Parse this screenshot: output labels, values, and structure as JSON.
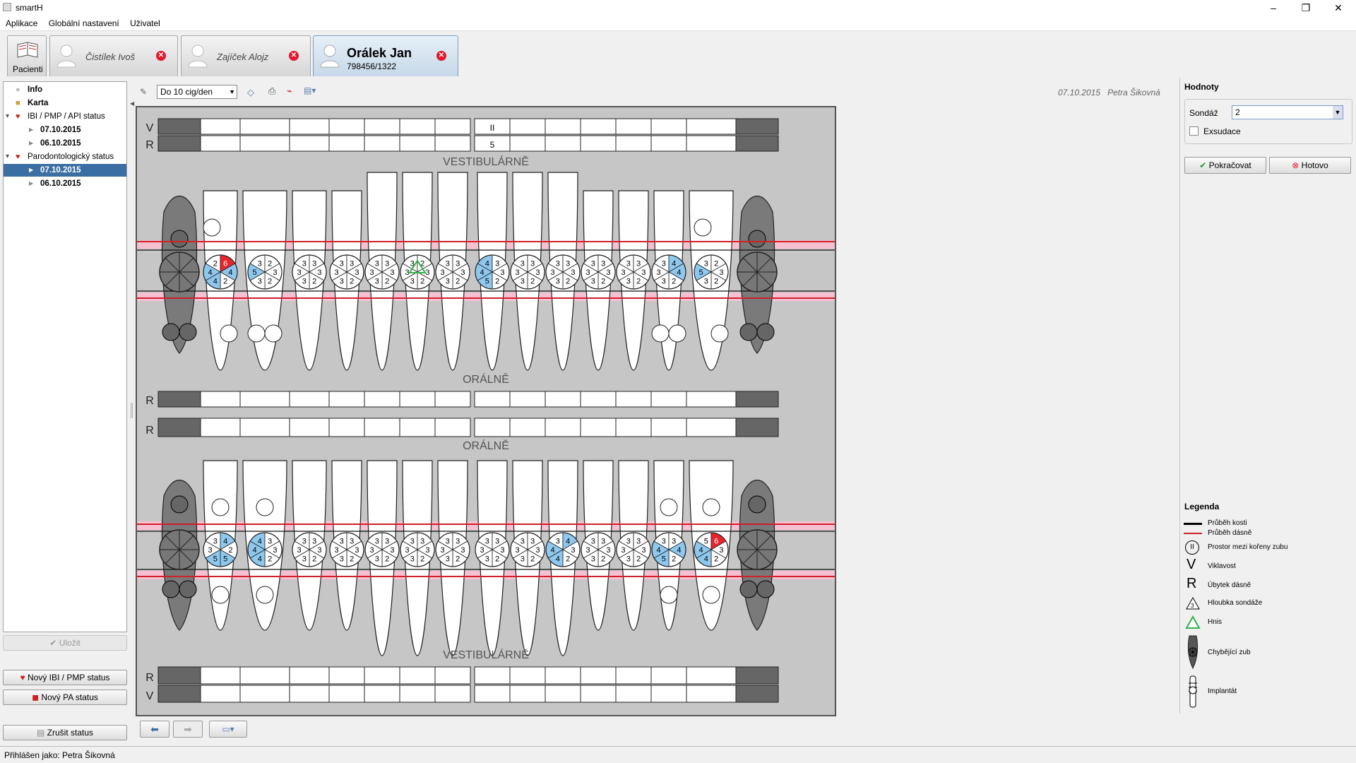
{
  "window": {
    "title": "smartH",
    "min": "–",
    "max": "❐",
    "close": "✕"
  },
  "menu": [
    "Aplikace",
    "Globální nastavení",
    "Uživatel"
  ],
  "tabs": {
    "patients_label": "Pacienti",
    "open": [
      {
        "name": "Čistílek Ivoš",
        "active": false
      },
      {
        "name": "Zajíček Alojz",
        "active": false
      },
      {
        "name": "Orálek Jan",
        "id": "798456/1322",
        "active": true
      }
    ]
  },
  "tree": {
    "items": [
      {
        "label": "Info",
        "level": 0,
        "icon": "person-icon"
      },
      {
        "label": "Karta",
        "level": 0,
        "icon": "folder-icon"
      },
      {
        "label": "IBI / PMP / API status",
        "level": 0,
        "icon": "tooth-icon",
        "expanded": true
      },
      {
        "label": "07.10.2015",
        "level": 1
      },
      {
        "label": "06.10.2015",
        "level": 1
      },
      {
        "label": "Parodontologický status",
        "level": 0,
        "icon": "tooth-icon",
        "expanded": true
      },
      {
        "label": "07.10.2015",
        "level": 1,
        "selected": true
      },
      {
        "label": "06.10.2015",
        "level": 1
      }
    ]
  },
  "left_buttons": {
    "save": "Uložit",
    "new_ibi": "Nový IBI / PMP status",
    "new_pa": "Nový PA status",
    "cancel_status": "Zrušit status"
  },
  "toolbar": {
    "smoking": "Do 10 cig/den",
    "date": "07.10.2015",
    "author": "Petra Šikovná"
  },
  "chart": {
    "row_labels": {
      "v": "V",
      "r": "R"
    },
    "vestibular": "VESTIBULÁRNĚ",
    "oral": "ORÁLNĚ",
    "upper_v_values": [
      "",
      "",
      "",
      "",
      "",
      "",
      "",
      "",
      "II",
      "",
      "",
      "",
      "",
      "",
      "",
      ""
    ],
    "upper_r_values": [
      "",
      "",
      "",
      "",
      "",
      "",
      "",
      "",
      "5",
      "",
      "",
      "",
      "",
      "",
      "",
      ""
    ],
    "upper_teeth": [
      {
        "missing": true
      },
      {
        "t": [
          "2",
          "6",
          "4",
          "2",
          "4",
          "4"
        ],
        "hi": [
          false,
          true,
          true,
          false,
          true,
          true
        ]
      },
      {
        "t": [
          "3",
          "2",
          "3",
          "2",
          "3",
          "5"
        ],
        "hi": [
          false,
          false,
          false,
          false,
          false,
          true
        ]
      },
      {
        "t": [
          "3",
          "3",
          "3",
          "2",
          "3",
          "3"
        ],
        "hi": [
          false,
          false,
          false,
          false,
          false,
          false
        ]
      },
      {
        "t": [
          "3",
          "3",
          "3",
          "2",
          "3",
          "3"
        ],
        "hi": [
          false,
          false,
          false,
          false,
          false,
          false
        ]
      },
      {
        "t": [
          "3",
          "3",
          "3",
          "2",
          "3",
          "3"
        ],
        "hi": [
          false,
          false,
          false,
          false,
          false,
          false
        ]
      },
      {
        "t": [
          "3",
          "2",
          "3",
          "2",
          "3",
          "3"
        ],
        "hi": [
          false,
          false,
          false,
          false,
          false,
          false
        ],
        "green": true
      },
      {
        "t": [
          "3",
          "3",
          "3",
          "2",
          "3",
          "3"
        ],
        "hi": [
          false,
          false,
          false,
          false,
          false,
          false
        ]
      },
      {
        "t": [
          "4",
          "3",
          "3",
          "2",
          "5",
          "4"
        ],
        "hi": [
          true,
          false,
          false,
          false,
          true,
          true
        ]
      },
      {
        "t": [
          "3",
          "3",
          "3",
          "2",
          "3",
          "3"
        ],
        "hi": [
          false,
          false,
          false,
          false,
          false,
          false
        ]
      },
      {
        "t": [
          "3",
          "3",
          "3",
          "2",
          "3",
          "3"
        ],
        "hi": [
          false,
          false,
          false,
          false,
          false,
          false
        ]
      },
      {
        "t": [
          "3",
          "3",
          "3",
          "2",
          "3",
          "3"
        ],
        "hi": [
          false,
          false,
          false,
          false,
          false,
          false
        ]
      },
      {
        "t": [
          "3",
          "3",
          "3",
          "2",
          "3",
          "3"
        ],
        "hi": [
          false,
          false,
          false,
          false,
          false,
          false
        ]
      },
      {
        "t": [
          "3",
          "4",
          "4",
          "2",
          "3",
          "3"
        ],
        "hi": [
          false,
          true,
          true,
          false,
          false,
          false
        ]
      },
      {
        "t": [
          "3",
          "2",
          "3",
          "2",
          "3",
          "5"
        ],
        "hi": [
          false,
          false,
          false,
          false,
          false,
          true
        ]
      },
      {
        "missing": true
      }
    ],
    "lower_teeth": [
      {
        "missing": true
      },
      {
        "t": [
          "3",
          "4",
          "2",
          "5",
          "5",
          "3"
        ],
        "hi": [
          false,
          true,
          false,
          true,
          true,
          false
        ]
      },
      {
        "t": [
          "4",
          "3",
          "3",
          "2",
          "4",
          "4"
        ],
        "hi": [
          true,
          false,
          false,
          false,
          true,
          true
        ]
      },
      {
        "t": [
          "3",
          "3",
          "3",
          "2",
          "3",
          "3"
        ],
        "hi": [
          false,
          false,
          false,
          false,
          false,
          false
        ]
      },
      {
        "t": [
          "3",
          "3",
          "3",
          "2",
          "3",
          "3"
        ],
        "hi": [
          false,
          false,
          false,
          false,
          false,
          false
        ]
      },
      {
        "t": [
          "3",
          "3",
          "3",
          "2",
          "3",
          "3"
        ],
        "hi": [
          false,
          false,
          false,
          false,
          false,
          false
        ]
      },
      {
        "t": [
          "3",
          "3",
          "3",
          "2",
          "3",
          "3"
        ],
        "hi": [
          false,
          false,
          false,
          false,
          false,
          false
        ]
      },
      {
        "t": [
          "3",
          "3",
          "3",
          "2",
          "3",
          "3"
        ],
        "hi": [
          false,
          false,
          false,
          false,
          false,
          false
        ]
      },
      {
        "t": [
          "3",
          "3",
          "3",
          "2",
          "3",
          "3"
        ],
        "hi": [
          false,
          false,
          false,
          false,
          false,
          false
        ]
      },
      {
        "t": [
          "3",
          "3",
          "3",
          "2",
          "3",
          "3"
        ],
        "hi": [
          false,
          false,
          false,
          false,
          false,
          false
        ]
      },
      {
        "t": [
          "3",
          "4",
          "3",
          "2",
          "4",
          "4"
        ],
        "hi": [
          false,
          true,
          false,
          false,
          true,
          true
        ]
      },
      {
        "t": [
          "3",
          "3",
          "3",
          "2",
          "3",
          "3"
        ],
        "hi": [
          false,
          false,
          false,
          false,
          false,
          false
        ]
      },
      {
        "t": [
          "3",
          "3",
          "3",
          "2",
          "3",
          "3"
        ],
        "hi": [
          false,
          false,
          false,
          false,
          false,
          false
        ]
      },
      {
        "t": [
          "3",
          "3",
          "4",
          "2",
          "5",
          "4"
        ],
        "hi": [
          false,
          false,
          true,
          false,
          true,
          true
        ]
      },
      {
        "t": [
          "5",
          "6",
          "3",
          "2",
          "4",
          "4"
        ],
        "hi": [
          false,
          true,
          false,
          false,
          true,
          true
        ]
      },
      {
        "missing": true
      }
    ]
  },
  "right": {
    "values_title": "Hodnoty",
    "probe_label": "Sondáž",
    "probe_value": "2",
    "exudation": "Exsudace",
    "continue": "Pokračovat",
    "done": "Hotovo",
    "legend_title": "Legenda",
    "legend": [
      {
        "label": "Průběh kosti",
        "icon": "black-line-icon"
      },
      {
        "label": "Průběh dásně",
        "icon": "red-line-icon"
      },
      {
        "label": "Prostor mezi kořeny zubu",
        "icon": "furcation-icon"
      },
      {
        "label": "Viklavost",
        "icon": "v-letter-icon"
      },
      {
        "label": "Úbytek dásně",
        "icon": "r-letter-icon"
      },
      {
        "label": "Hloubka sondáže",
        "icon": "probe-depth-icon"
      },
      {
        "label": "Hnis",
        "icon": "green-triangle-icon"
      },
      {
        "label": "Chybějící zub",
        "icon": "missing-tooth-icon"
      },
      {
        "label": "Implantát",
        "icon": "implant-icon"
      }
    ]
  },
  "status": "Přihlášen jako: Petra Šikovná",
  "colors": {
    "accent": "#3b6ea3",
    "blue_cell": "#8ec8ef",
    "red_cell": "#e8242c",
    "gum": "#f7c0d2",
    "gum_line": "#d0202a"
  }
}
